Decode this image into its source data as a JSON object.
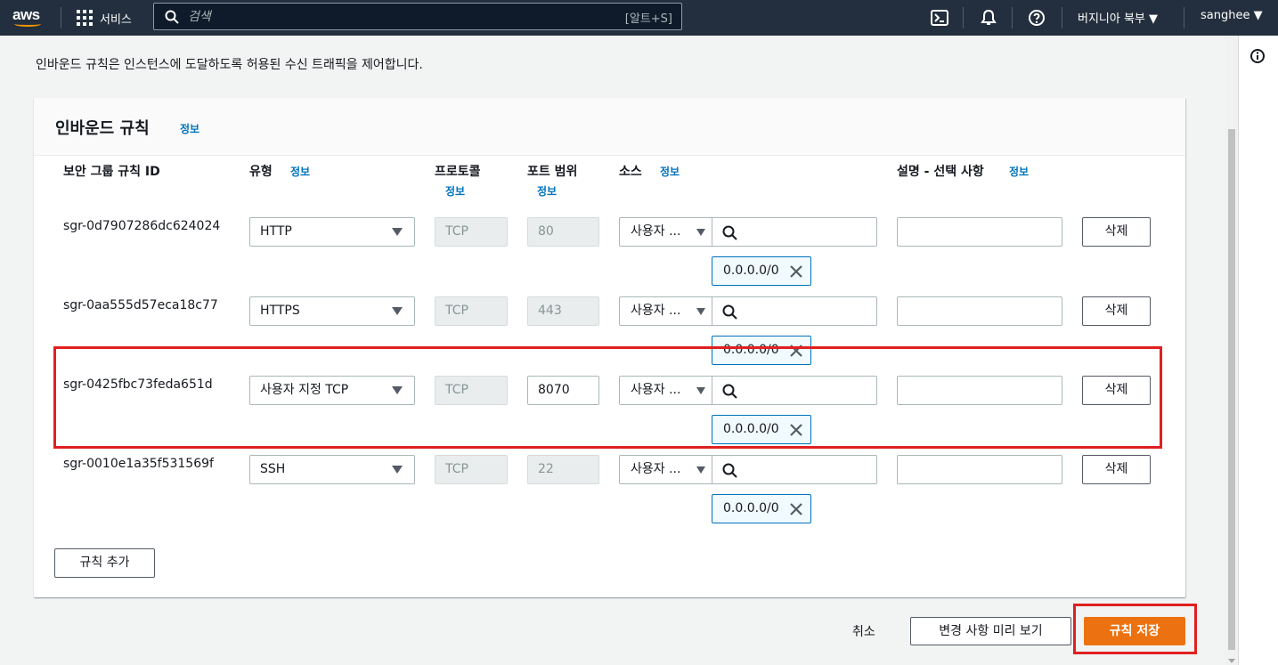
{
  "nav": {
    "logo_text": "aws",
    "services_label": "서비스",
    "search_placeholder": "검색",
    "search_shortcut": "[알트+S]",
    "region": "버지니아 북부 ▼",
    "user": "sanghee ▼"
  },
  "description": "인바운드 규칙은 인스턴스에 도달하도록 허용된 수신 트래픽을 제어합니다.",
  "panel": {
    "title": "인바운드 규칙",
    "info": "정보",
    "columns": {
      "rule_id": "보안 그룹 규칙 ID",
      "type": "유형",
      "protocol": "프로토콜",
      "port_range": "포트 범위",
      "source": "소스",
      "description": "설명 - 선택 사항"
    }
  },
  "rules": [
    {
      "id": "sgr-0d7907286dc624024",
      "type": "HTTP",
      "protocol": "TCP",
      "port": "80",
      "source": "사용자 ...",
      "cidr": "0.0.0.0/0",
      "delete": "삭제"
    },
    {
      "id": "sgr-0aa555d57eca18c77",
      "type": "HTTPS",
      "protocol": "TCP",
      "port": "443",
      "source": "사용자 ...",
      "cidr": "0.0.0.0/0",
      "delete": "삭제"
    },
    {
      "id": "sgr-0425fbc73feda651d",
      "type": "사용자 지정 TCP",
      "protocol": "TCP",
      "port": "8070",
      "source": "사용자 ...",
      "cidr": "0.0.0.0/0",
      "delete": "삭제"
    },
    {
      "id": "sgr-0010e1a35f531569f",
      "type": "SSH",
      "protocol": "TCP",
      "port": "22",
      "source": "사용자 ...",
      "cidr": "0.0.0.0/0",
      "delete": "삭제"
    }
  ],
  "actions": {
    "add_rule": "규칙 추가",
    "cancel": "취소",
    "preview": "변경 사항 미리 보기",
    "save": "규칙 저장"
  },
  "colors": {
    "nav_bg": "#232f3e",
    "accent_orange": "#ec7211",
    "link_blue": "#0073bb",
    "highlight_red": "#e02020"
  }
}
